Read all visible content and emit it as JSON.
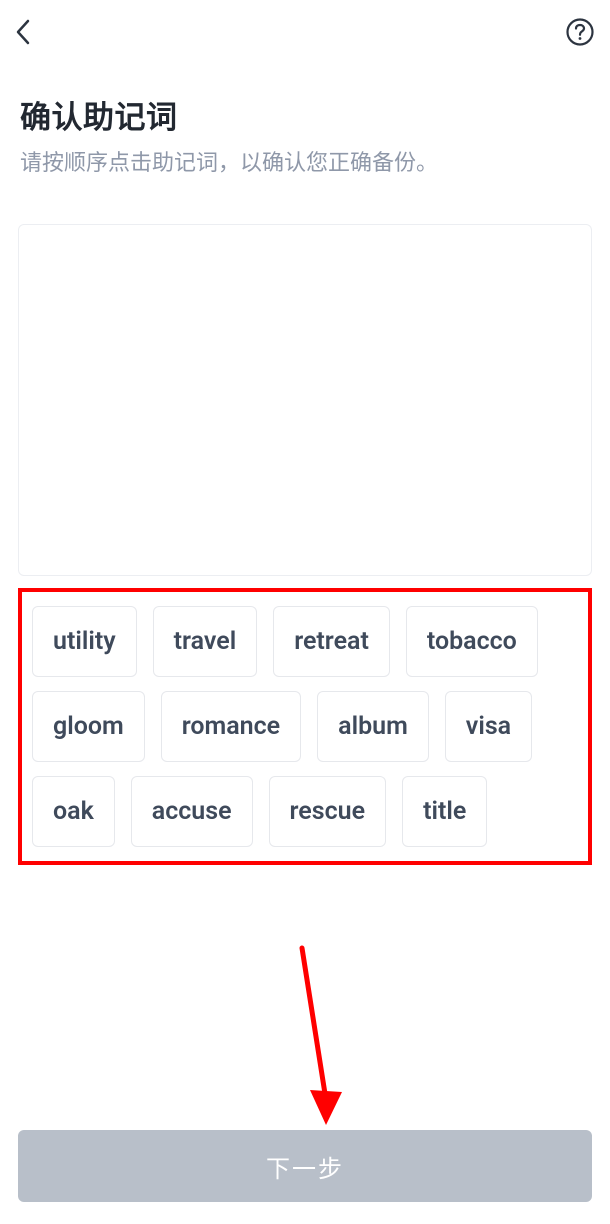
{
  "header": {
    "title": "确认助记词",
    "subtitle": "请按顺序点击助记词，以确认您正确备份。"
  },
  "words": [
    [
      "utility",
      "travel",
      "retreat",
      "tobacco"
    ],
    [
      "gloom",
      "romance",
      "album",
      "visa"
    ],
    [
      "oak",
      "accuse",
      "rescue",
      "title"
    ]
  ],
  "footer": {
    "next_label": "下一步"
  },
  "annotations": {
    "highlight_color": "#ff0000"
  }
}
